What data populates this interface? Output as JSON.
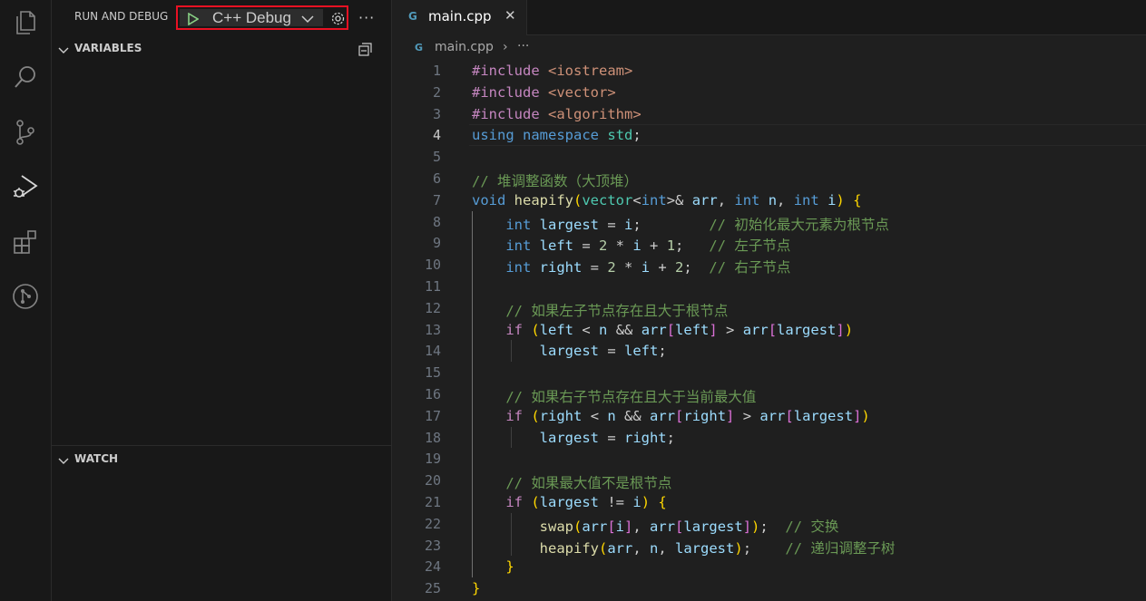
{
  "activity_bar": {
    "items": [
      {
        "icon": "explorer-icon"
      },
      {
        "icon": "search-icon"
      },
      {
        "icon": "source-control-icon"
      },
      {
        "icon": "run-and-debug-icon",
        "active": true
      },
      {
        "icon": "extensions-icon"
      },
      {
        "icon": "git-graph-icon"
      }
    ]
  },
  "sidebar": {
    "title": "RUN AND DEBUG",
    "config_label": "C++ Debug",
    "more_label": "···",
    "variables_label": "VARIABLES",
    "watch_label": "WATCH"
  },
  "editor": {
    "tab_icon": "G",
    "tab_label": "main.cpp",
    "tab_close": "✕",
    "breadcrumb_file": "main.cpp",
    "breadcrumb_sep": "›",
    "breadcrumb_more": "···",
    "current_line": 4,
    "lines": [
      {
        "n": "1",
        "text": "#include <iostream>"
      },
      {
        "n": "2",
        "text": "#include <vector>"
      },
      {
        "n": "3",
        "text": "#include <algorithm>"
      },
      {
        "n": "4",
        "text": "using namespace std;"
      },
      {
        "n": "5",
        "text": ""
      },
      {
        "n": "6",
        "text": "// 堆调整函数（大顶堆）"
      },
      {
        "n": "7",
        "text": "void heapify(vector<int>& arr, int n, int i) {"
      },
      {
        "n": "8",
        "text": "    int largest = i;        // 初始化最大元素为根节点"
      },
      {
        "n": "9",
        "text": "    int left = 2 * i + 1;   // 左子节点"
      },
      {
        "n": "10",
        "text": "    int right = 2 * i + 2;  // 右子节点"
      },
      {
        "n": "11",
        "text": ""
      },
      {
        "n": "12",
        "text": "    // 如果左子节点存在且大于根节点"
      },
      {
        "n": "13",
        "text": "    if (left < n && arr[left] > arr[largest])"
      },
      {
        "n": "14",
        "text": "        largest = left;"
      },
      {
        "n": "15",
        "text": ""
      },
      {
        "n": "16",
        "text": "    // 如果右子节点存在且大于当前最大值"
      },
      {
        "n": "17",
        "text": "    if (right < n && arr[right] > arr[largest])"
      },
      {
        "n": "18",
        "text": "        largest = right;"
      },
      {
        "n": "19",
        "text": ""
      },
      {
        "n": "20",
        "text": "    // 如果最大值不是根节点"
      },
      {
        "n": "21",
        "text": "    if (largest != i) {"
      },
      {
        "n": "22",
        "text": "        swap(arr[i], arr[largest]);  // 交换"
      },
      {
        "n": "23",
        "text": "        heapify(arr, n, largest);    // 递归调整子树"
      },
      {
        "n": "24",
        "text": "    }"
      },
      {
        "n": "25",
        "text": "}"
      }
    ]
  },
  "colors": {
    "keyword": "#569cd6",
    "control": "#c586c0",
    "string": "#ce9178",
    "function": "#dcdcaa",
    "type": "#4ec9b0",
    "variable": "#9cdcfe",
    "comment": "#6a9955",
    "number": "#b5cea8",
    "highlight_border": "#e81123",
    "play_green": "#89d185"
  }
}
